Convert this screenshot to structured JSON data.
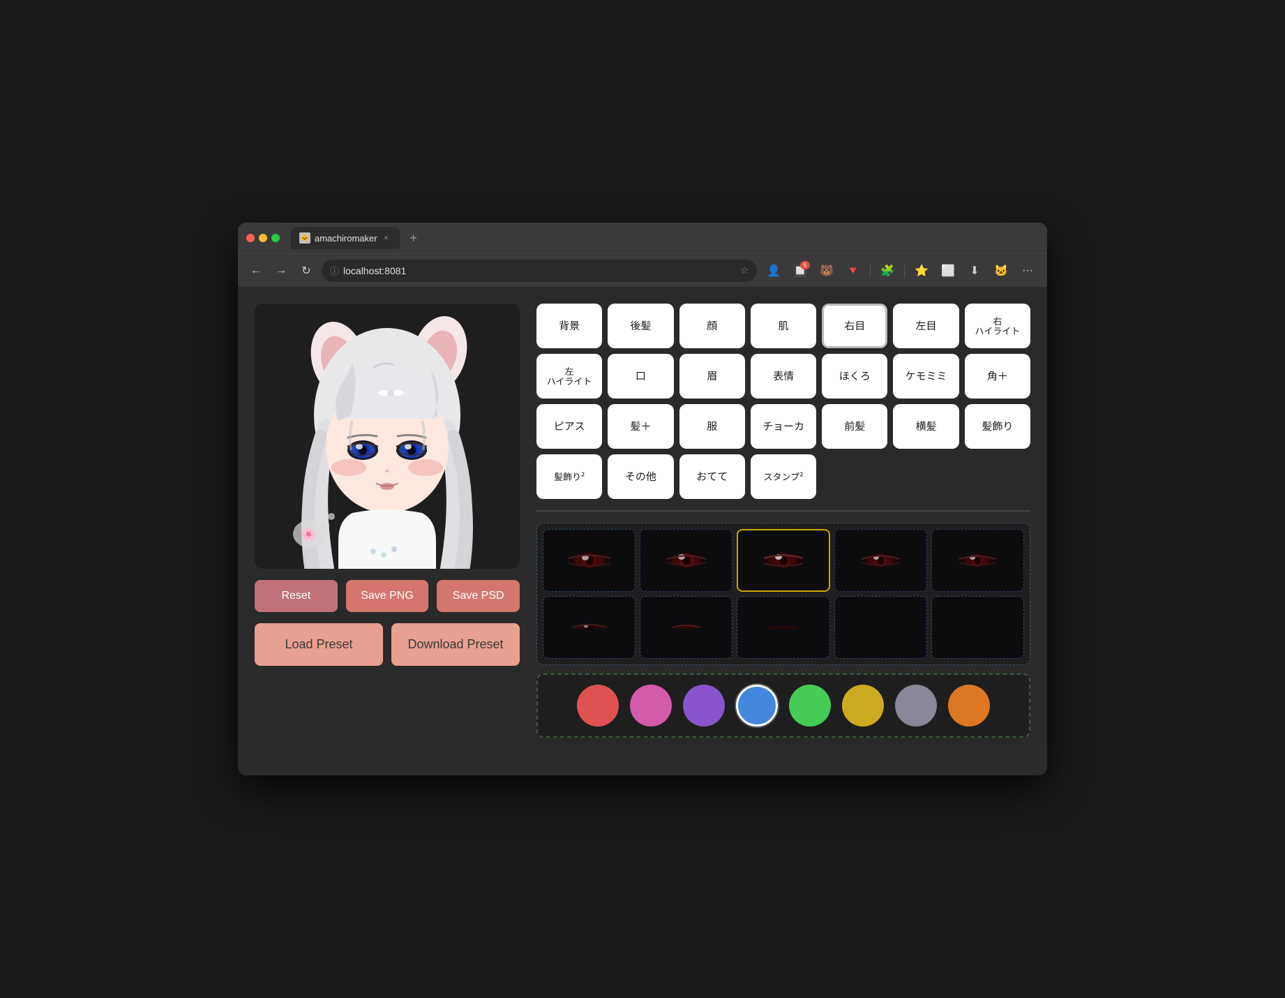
{
  "browser": {
    "traffic_lights": [
      "red",
      "yellow",
      "green"
    ],
    "tab_title": "amachiromaker",
    "tab_close": "×",
    "new_tab": "+",
    "nav_back": "←",
    "nav_forward": "→",
    "nav_reload": "↻",
    "address_url": "localhost:8081",
    "nav_icons": [
      "⭐",
      "👤",
      "🔲",
      "🔻",
      "🧩",
      "⭐",
      "⬜",
      "⬇",
      "👤",
      "···"
    ]
  },
  "categories": [
    {
      "id": "bg",
      "label": "背景",
      "active": false
    },
    {
      "id": "back-hair",
      "label": "後髪",
      "active": false
    },
    {
      "id": "face",
      "label": "顔",
      "active": false
    },
    {
      "id": "skin",
      "label": "肌",
      "active": false
    },
    {
      "id": "right-eye",
      "label": "右目",
      "active": true
    },
    {
      "id": "left-eye",
      "label": "左目",
      "active": false
    },
    {
      "id": "right-highlight",
      "label": "右\nハイライト",
      "active": false
    },
    {
      "id": "left-highlight",
      "label": "左\nハイライト",
      "active": false
    },
    {
      "id": "mouth",
      "label": "口",
      "active": false
    },
    {
      "id": "eyebrow",
      "label": "眉",
      "active": false
    },
    {
      "id": "expression",
      "label": "表情",
      "active": false
    },
    {
      "id": "blush",
      "label": "ほくろ",
      "active": false
    },
    {
      "id": "fur",
      "label": "ケモミミ",
      "active": false
    },
    {
      "id": "horn",
      "label": "角＋",
      "active": false
    },
    {
      "id": "earring",
      "label": "ピアス",
      "active": false
    },
    {
      "id": "hair-plus",
      "label": "髪＋",
      "active": false
    },
    {
      "id": "clothes",
      "label": "服",
      "active": false
    },
    {
      "id": "choker",
      "label": "チョーカ",
      "active": false
    },
    {
      "id": "front-hair",
      "label": "前髪",
      "active": false
    },
    {
      "id": "side-hair",
      "label": "横髪",
      "active": false
    },
    {
      "id": "hair-deco",
      "label": "髪飾り",
      "active": false
    },
    {
      "id": "hair-deco2",
      "label": "髪飾り²",
      "active": false
    },
    {
      "id": "other",
      "label": "その他",
      "active": false
    },
    {
      "id": "hand",
      "label": "おてて",
      "active": false
    },
    {
      "id": "stamp",
      "label": "スタンプ²",
      "active": false
    }
  ],
  "action_buttons": {
    "reset": "Reset",
    "save_png": "Save PNG",
    "save_psd": "Save PSD"
  },
  "preset_buttons": {
    "load": "Load Preset",
    "download": "Download Preset"
  },
  "eye_items": [
    {
      "row": 0,
      "col": 0,
      "selected": false,
      "type": "eye1"
    },
    {
      "row": 0,
      "col": 1,
      "selected": false,
      "type": "eye2"
    },
    {
      "row": 0,
      "col": 2,
      "selected": true,
      "type": "eye3"
    },
    {
      "row": 0,
      "col": 3,
      "selected": false,
      "type": "eye4"
    },
    {
      "row": 0,
      "col": 4,
      "selected": false,
      "type": "eye5"
    },
    {
      "row": 1,
      "col": 0,
      "selected": false,
      "type": "eye6"
    },
    {
      "row": 1,
      "col": 1,
      "selected": false,
      "type": "eye7"
    },
    {
      "row": 1,
      "col": 2,
      "selected": false,
      "type": "eye8"
    },
    {
      "row": 1,
      "col": 3,
      "selected": false,
      "type": "empty"
    },
    {
      "row": 1,
      "col": 4,
      "selected": false,
      "type": "empty"
    }
  ],
  "colors": [
    {
      "name": "red",
      "hex": "#e05252",
      "active": false
    },
    {
      "name": "pink",
      "hex": "#d45aaa",
      "active": false
    },
    {
      "name": "purple",
      "hex": "#8855cc",
      "active": false
    },
    {
      "name": "blue",
      "hex": "#4488dd",
      "active": true
    },
    {
      "name": "green",
      "hex": "#44cc55",
      "active": false
    },
    {
      "name": "yellow",
      "hex": "#ccaa22",
      "active": false
    },
    {
      "name": "gray",
      "hex": "#888899",
      "active": false
    },
    {
      "name": "orange",
      "hex": "#dd7722",
      "active": false
    }
  ]
}
